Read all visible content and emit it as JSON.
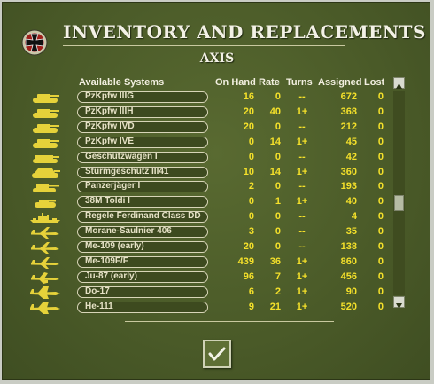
{
  "title": "INVENTORY AND REPLACEMENTS",
  "subtitle": "AXIS",
  "headers": {
    "systems": "Available Systems",
    "on_hand": "On Hand",
    "rate": "Rate",
    "turns": "Turns",
    "assigned": "Assigned",
    "lost": "Lost"
  },
  "colors": {
    "panel": "#4e5e2b",
    "value_text": "#f4e02a",
    "silhouette": "#e6d23a",
    "name_text": "#e6e2c6"
  },
  "rows": [
    {
      "name": "PzKpfw IIIG",
      "type": "tank",
      "on_hand": "16",
      "rate": "0",
      "turns": "--",
      "assigned": "672",
      "lost": "0"
    },
    {
      "name": "PzKpfw IIIH",
      "type": "tank",
      "on_hand": "20",
      "rate": "40",
      "turns": "1+",
      "assigned": "368",
      "lost": "0"
    },
    {
      "name": "PzKpfw IVD",
      "type": "tank",
      "on_hand": "20",
      "rate": "0",
      "turns": "--",
      "assigned": "212",
      "lost": "0"
    },
    {
      "name": "PzKpfw IVE",
      "type": "tank",
      "on_hand": "0",
      "rate": "14",
      "turns": "1+",
      "assigned": "45",
      "lost": "0"
    },
    {
      "name": "Geschützwagen I",
      "type": "spg",
      "on_hand": "0",
      "rate": "0",
      "turns": "--",
      "assigned": "42",
      "lost": "0"
    },
    {
      "name": "Sturmgeschütz III41",
      "type": "assault-gun",
      "on_hand": "10",
      "rate": "14",
      "turns": "1+",
      "assigned": "360",
      "lost": "0"
    },
    {
      "name": "Panzerjäger I",
      "type": "tank-destroyer",
      "on_hand": "2",
      "rate": "0",
      "turns": "--",
      "assigned": "193",
      "lost": "0"
    },
    {
      "name": "38M Toldi I",
      "type": "light-tank",
      "on_hand": "0",
      "rate": "1",
      "turns": "1+",
      "assigned": "40",
      "lost": "0"
    },
    {
      "name": "Regele Ferdinand Class DD",
      "type": "ship",
      "on_hand": "0",
      "rate": "0",
      "turns": "--",
      "assigned": "4",
      "lost": "0"
    },
    {
      "name": "Morane-Saulnier 406",
      "type": "fighter",
      "on_hand": "3",
      "rate": "0",
      "turns": "--",
      "assigned": "35",
      "lost": "0"
    },
    {
      "name": "Me-109 (early)",
      "type": "fighter",
      "on_hand": "20",
      "rate": "0",
      "turns": "--",
      "assigned": "138",
      "lost": "0"
    },
    {
      "name": "Me-109F/F",
      "type": "fighter",
      "on_hand": "439",
      "rate": "36",
      "turns": "1+",
      "assigned": "860",
      "lost": "0"
    },
    {
      "name": "Ju-87 (early)",
      "type": "dive-bomber",
      "on_hand": "96",
      "rate": "7",
      "turns": "1+",
      "assigned": "456",
      "lost": "0"
    },
    {
      "name": "Do-17",
      "type": "bomber",
      "on_hand": "6",
      "rate": "2",
      "turns": "1+",
      "assigned": "90",
      "lost": "0"
    },
    {
      "name": "He-111",
      "type": "bomber",
      "on_hand": "9",
      "rate": "21",
      "turns": "1+",
      "assigned": "520",
      "lost": "0"
    }
  ],
  "icons": {
    "emblem": "iron-cross-icon",
    "scroll_up": "up-arrow-icon",
    "scroll_down": "down-arrow-icon",
    "ok": "checkmark-icon"
  },
  "scroll": {
    "position": 0.55
  }
}
